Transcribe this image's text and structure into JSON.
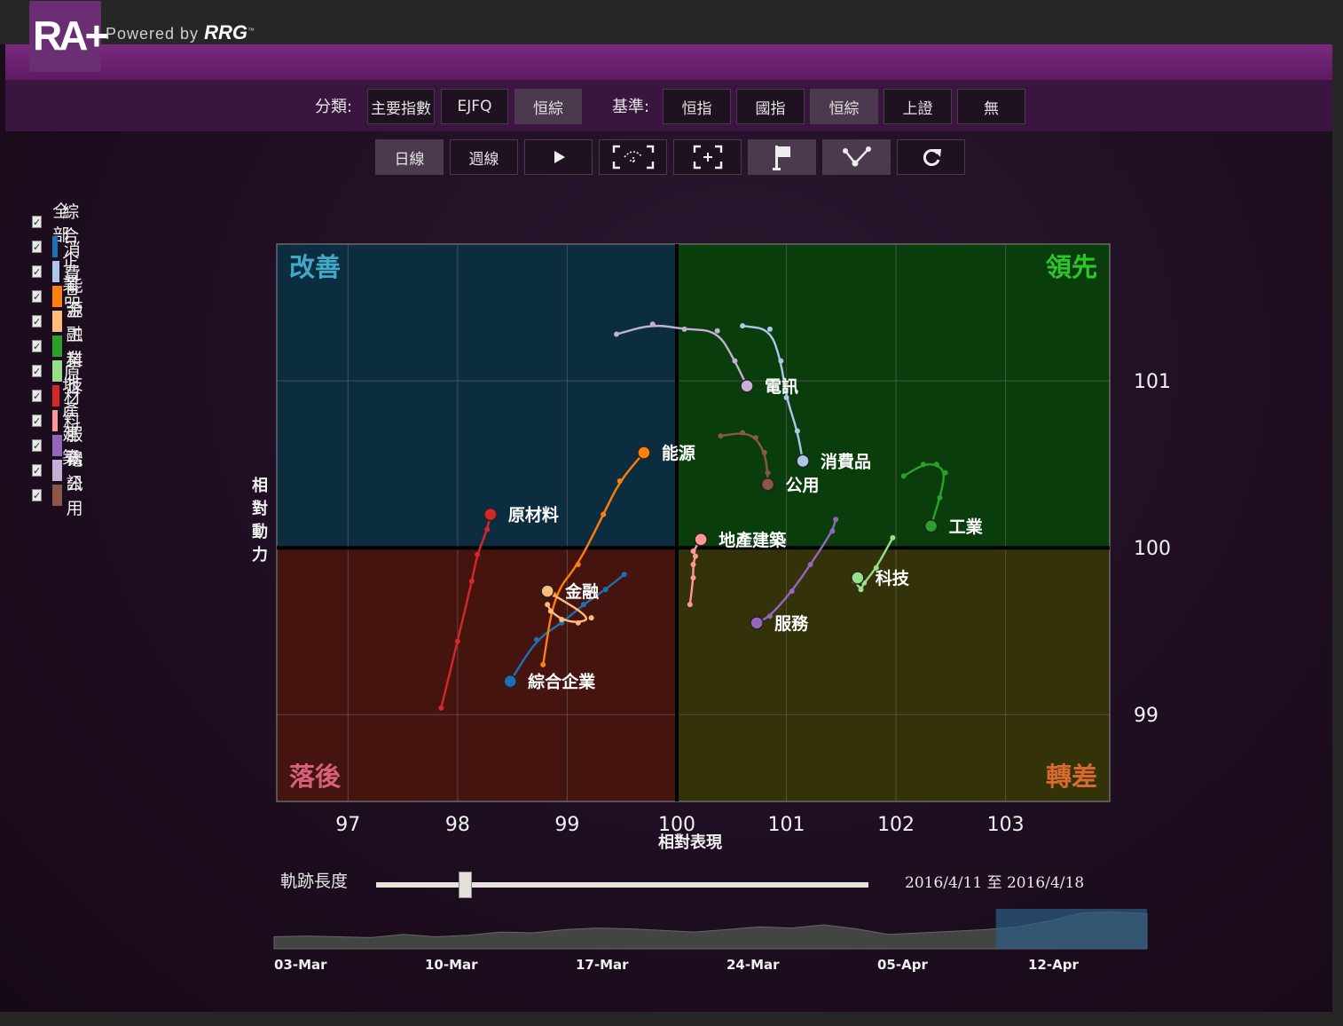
{
  "logo": {
    "text": "RA+",
    "powered_by": "Powered by",
    "brand": "RRG",
    "brand_mark": "™"
  },
  "toolbar": {
    "category_label": "分類:",
    "category_buttons": [
      "主要指數",
      "EJFQ",
      "恒綜"
    ],
    "category_active": 2,
    "benchmark_label": "基準:",
    "benchmark_buttons": [
      "恒指",
      "國指",
      "恒綜",
      "上證",
      "無"
    ],
    "benchmark_active": 2,
    "period_buttons": [
      "日線",
      "週線"
    ],
    "period_active": 0,
    "tools": [
      "play-icon",
      "zoom-area-icon",
      "zoom-fit-icon",
      "flag-icon",
      "tail-icon",
      "refresh-icon"
    ]
  },
  "legend": {
    "all_label": "全部",
    "items": [
      {
        "name": "綜合企業",
        "color": "#1f6fb4"
      },
      {
        "name": "消費品",
        "color": "#aec7e8"
      },
      {
        "name": "能源",
        "color": "#ff7f0e"
      },
      {
        "name": "金融",
        "color": "#ffbb78"
      },
      {
        "name": "工業",
        "color": "#2ca02c"
      },
      {
        "name": "科技",
        "color": "#98df8a"
      },
      {
        "name": "原材料",
        "color": "#d62728"
      },
      {
        "name": "地產建築",
        "color": "#ff9896"
      },
      {
        "name": "服務",
        "color": "#9467bd"
      },
      {
        "name": "電訊",
        "color": "#c5b0d5"
      },
      {
        "name": "公用",
        "color": "#8c564b"
      }
    ]
  },
  "slider": {
    "label": "軌跡長度",
    "range_text": "2016/4/11 至 2016/4/18",
    "value_fraction": 0.18
  },
  "timeline": {
    "dates": [
      "03-Mar",
      "10-Mar",
      "17-Mar",
      "24-Mar",
      "05-Apr",
      "12-Apr"
    ],
    "values": [
      0.3,
      0.32,
      0.3,
      0.28,
      0.36,
      0.3,
      0.34,
      0.42,
      0.4,
      0.48,
      0.52,
      0.5,
      0.46,
      0.42,
      0.48,
      0.55,
      0.52,
      0.6,
      0.5,
      0.36,
      0.4,
      0.44,
      0.48,
      0.55,
      0.7,
      0.9,
      0.92,
      0.88
    ],
    "selected_start_fraction": 0.827,
    "selected_end_fraction": 1.0
  },
  "chart_data": {
    "type": "scatter",
    "xlabel": "相對表現",
    "ylabel": "相對動力",
    "xlim": [
      96.35,
      103.95
    ],
    "ylim": [
      98.48,
      101.82
    ],
    "xticks": [
      97,
      98,
      99,
      100,
      101,
      102,
      103
    ],
    "yticks": [
      99,
      100,
      101
    ],
    "center": [
      100,
      100
    ],
    "grid": true,
    "quadrants": [
      {
        "name": "改善",
        "position": "top-left",
        "color": "#0c2d40",
        "text_color": "#3fa9c6"
      },
      {
        "name": "領先",
        "position": "top-right",
        "color": "#0a3d0c",
        "text_color": "#2ec42e"
      },
      {
        "name": "落後",
        "position": "bottom-left",
        "color": "#45140e",
        "text_color": "#d8607a"
      },
      {
        "name": "轉差",
        "position": "bottom-right",
        "color": "#333208",
        "text_color": "#d86a30"
      }
    ],
    "series": [
      {
        "name": "綜合企業",
        "color": "#1f6fb4",
        "points": [
          [
            99.52,
            99.84
          ],
          [
            99.35,
            99.75
          ],
          [
            99.15,
            99.66
          ],
          [
            98.95,
            99.55
          ],
          [
            98.72,
            99.45
          ],
          [
            98.48,
            99.2
          ]
        ]
      },
      {
        "name": "消費品",
        "color": "#aec7e8",
        "points": [
          [
            100.6,
            101.33
          ],
          [
            100.85,
            101.31
          ],
          [
            100.95,
            101.12
          ],
          [
            101.0,
            100.9
          ],
          [
            101.1,
            100.7
          ],
          [
            101.15,
            100.52
          ]
        ]
      },
      {
        "name": "能源",
        "color": "#ff7f0e",
        "points": [
          [
            98.78,
            99.3
          ],
          [
            98.88,
            99.72
          ],
          [
            99.1,
            99.9
          ],
          [
            99.33,
            100.2
          ],
          [
            99.48,
            100.4
          ],
          [
            99.7,
            100.57
          ]
        ]
      },
      {
        "name": "金融",
        "color": "#ffbb78",
        "points": [
          [
            98.82,
            99.66
          ],
          [
            98.85,
            99.62
          ],
          [
            98.95,
            99.57
          ],
          [
            99.1,
            99.55
          ],
          [
            99.22,
            99.58
          ],
          [
            98.82,
            99.74
          ]
        ]
      },
      {
        "name": "工業",
        "color": "#2ca02c",
        "points": [
          [
            102.07,
            100.43
          ],
          [
            102.25,
            100.5
          ],
          [
            102.37,
            100.5
          ],
          [
            102.45,
            100.45
          ],
          [
            102.4,
            100.3
          ],
          [
            102.32,
            100.13
          ]
        ]
      },
      {
        "name": "科技",
        "color": "#98df8a",
        "points": [
          [
            101.97,
            100.06
          ],
          [
            101.82,
            99.88
          ],
          [
            101.71,
            99.79
          ],
          [
            101.68,
            99.75
          ],
          [
            101.62,
            99.8
          ],
          [
            101.65,
            99.82
          ]
        ]
      },
      {
        "name": "原材料",
        "color": "#d62728",
        "points": [
          [
            97.85,
            99.04
          ],
          [
            98.0,
            99.44
          ],
          [
            98.13,
            99.8
          ],
          [
            98.18,
            99.96
          ],
          [
            98.27,
            100.11
          ],
          [
            98.3,
            100.2
          ]
        ]
      },
      {
        "name": "地產建築",
        "color": "#ff9896",
        "points": [
          [
            100.12,
            99.66
          ],
          [
            100.15,
            99.82
          ],
          [
            100.15,
            99.9
          ],
          [
            100.17,
            99.95
          ],
          [
            100.15,
            99.98
          ],
          [
            100.22,
            100.05
          ]
        ]
      },
      {
        "name": "服務",
        "color": "#9467bd",
        "points": [
          [
            101.45,
            100.17
          ],
          [
            101.42,
            100.1
          ],
          [
            101.22,
            99.9
          ],
          [
            101.05,
            99.74
          ],
          [
            100.85,
            99.59
          ],
          [
            100.73,
            99.55
          ]
        ]
      },
      {
        "name": "電訊",
        "color": "#c5b0d5",
        "points": [
          [
            99.45,
            101.28
          ],
          [
            99.78,
            101.34
          ],
          [
            100.07,
            101.31
          ],
          [
            100.37,
            101.3
          ],
          [
            100.53,
            101.12
          ],
          [
            100.64,
            100.97
          ]
        ]
      },
      {
        "name": "公用",
        "color": "#8c564b",
        "points": [
          [
            100.4,
            100.67
          ],
          [
            100.6,
            100.69
          ],
          [
            100.72,
            100.66
          ],
          [
            100.8,
            100.57
          ],
          [
            100.83,
            100.45
          ],
          [
            100.83,
            100.38
          ]
        ]
      }
    ],
    "labels": [
      {
        "name": "電訊",
        "dx": 20,
        "dy": 0
      },
      {
        "name": "消費品",
        "dx": 20,
        "dy": 0
      },
      {
        "name": "能源",
        "dx": 20,
        "dy": 0
      },
      {
        "name": "公用",
        "dx": 20,
        "dy": 0
      },
      {
        "name": "原材料",
        "dx": 20,
        "dy": 0
      },
      {
        "name": "工業",
        "dx": 20,
        "dy": 0
      },
      {
        "name": "地產建築",
        "dx": 20,
        "dy": 0
      },
      {
        "name": "科技",
        "dx": 20,
        "dy": 0
      },
      {
        "name": "金融",
        "dx": 20,
        "dy": 0
      },
      {
        "name": "服務",
        "dx": 20,
        "dy": 0
      },
      {
        "name": "綜合企業",
        "dx": 20,
        "dy": 0
      }
    ]
  }
}
